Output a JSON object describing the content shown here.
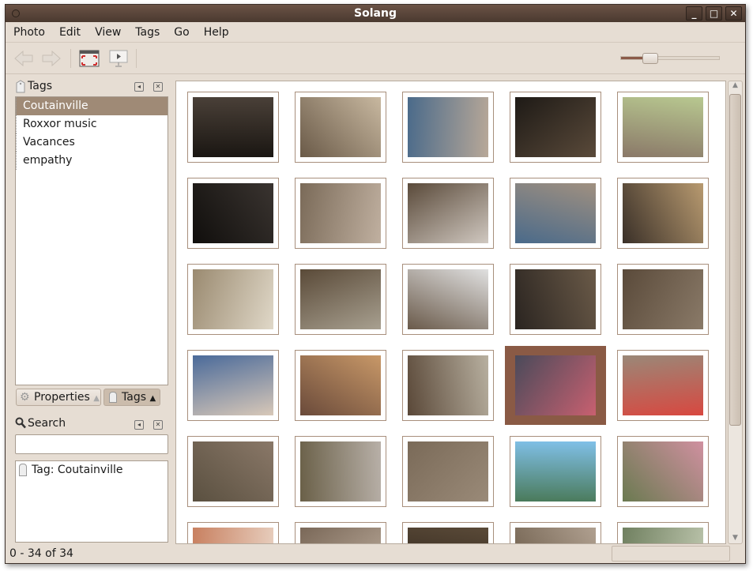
{
  "window": {
    "title": "Solang"
  },
  "menu": [
    {
      "label": "Photo"
    },
    {
      "label": "Edit"
    },
    {
      "label": "View"
    },
    {
      "label": "Tags"
    },
    {
      "label": "Go"
    },
    {
      "label": "Help"
    }
  ],
  "zoom": {
    "value": 0.3
  },
  "tags_panel": {
    "title": "Tags",
    "items": [
      {
        "label": "Coutainville",
        "selected": true
      },
      {
        "label": "Roxxor music"
      },
      {
        "label": "Vacances"
      },
      {
        "label": "empathy"
      }
    ]
  },
  "bottom_tabs": {
    "properties": "Properties",
    "tags": "Tags"
  },
  "search_panel": {
    "title": "Search",
    "input_value": "",
    "results": [
      {
        "label": "Tag: Coutainville"
      }
    ]
  },
  "thumbnails": [
    [
      "#1a1612",
      "#4a4038"
    ],
    [
      "#6a5a48",
      "#c8b8a0"
    ],
    [
      "#4a6a8a",
      "#b8a898"
    ],
    [
      "#1e1a16",
      "#5a4a3a"
    ],
    [
      "#8a7868",
      "#b8c890"
    ],
    [
      "#100e0c",
      "#3a3430"
    ],
    [
      "#7a6a58",
      "#c0b0a0"
    ],
    [
      "#5a4a3a",
      "#d0c8c0"
    ],
    [
      "#4a6a8a",
      "#a09080"
    ],
    [
      "#3a3028",
      "#b89a70"
    ],
    [
      "#9a8a70",
      "#e0d8c8"
    ],
    [
      "#5a4a38",
      "#a8a090"
    ],
    [
      "#6a5a4a",
      "#e0e0e0"
    ],
    [
      "#2a2420",
      "#6a5a48"
    ],
    [
      "#5a4a3a",
      "#8a7a68"
    ],
    [
      "#4a6a9a",
      "#d8c8b8"
    ],
    [
      "#6a4a3a",
      "#c89868"
    ],
    [
      "#5a4838",
      "#b8b0a0"
    ],
    [
      "#4a4a5a",
      "#c86070"
    ],
    [
      "#9a8878",
      "#d84840"
    ],
    [
      "#5a5040",
      "#8a7868"
    ],
    [
      "#6a6048",
      "#b8b0a8"
    ],
    [
      "#7a6a58",
      "#9a8a78"
    ],
    [
      "#4a7a5a",
      "#80c0e8"
    ],
    [
      "#6a7a50",
      "#d090a0"
    ],
    [
      "#c88060",
      "#e8d0c0"
    ],
    [
      "#7a6858",
      "#c0b0a0"
    ],
    [
      "#2a2018",
      "#5a4a38"
    ],
    [
      "#6a5a48",
      "#b0a090"
    ],
    [
      "#708060",
      "#c0c8b0"
    ]
  ],
  "selected_thumbnail": 18,
  "status": {
    "range": "0 - 34 of 34"
  }
}
